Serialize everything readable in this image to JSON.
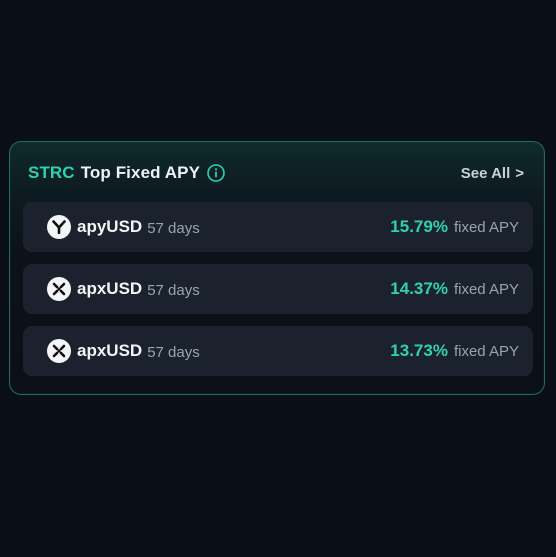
{
  "card": {
    "title_ticker": "STRC",
    "title_text": "Top Fixed APY",
    "see_all_label": "See All",
    "see_all_chevron": ">"
  },
  "colors": {
    "accent": "#2fd1b0",
    "background": "#0a0e17",
    "row_background": "#1c222d",
    "border": "#1f6b5e"
  },
  "rows": [
    {
      "icon": "y-logo-icon",
      "token": "apyUSD",
      "duration": "57 days",
      "apy": "15.79%",
      "apy_label": "fixed APY"
    },
    {
      "icon": "x-logo-icon",
      "token": "apxUSD",
      "duration": "57 days",
      "apy": "14.37%",
      "apy_label": "fixed APY"
    },
    {
      "icon": "x-logo-icon",
      "token": "apxUSD",
      "duration": "57 days",
      "apy": "13.73%",
      "apy_label": "fixed APY"
    }
  ]
}
